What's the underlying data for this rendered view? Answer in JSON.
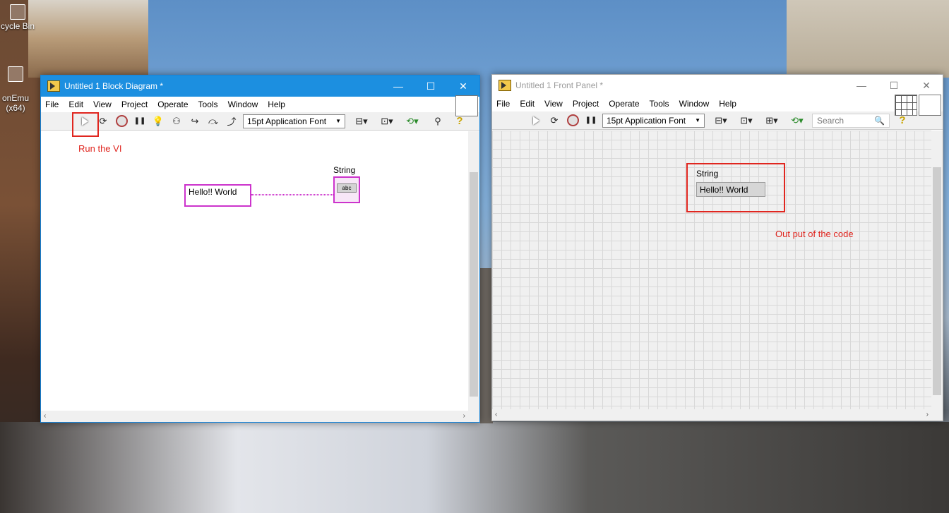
{
  "desktop": {
    "icons": [
      {
        "label": "cycle Bin"
      },
      {
        "label": "onEmu\n(x64)"
      }
    ]
  },
  "block_diagram": {
    "title": "Untitled 1 Block Diagram *",
    "menu": [
      "File",
      "Edit",
      "View",
      "Project",
      "Operate",
      "Tools",
      "Window",
      "Help"
    ],
    "font_select": "15pt Application Font",
    "annotation": "Run the VI",
    "constant_value": "Hello!! World",
    "indicator_label": "String",
    "indicator_type": "abc",
    "colors": {
      "wire": "#cc33cc",
      "annotation": "#e0261f"
    }
  },
  "front_panel": {
    "title": "Untitled 1 Front Panel *",
    "menu": [
      "File",
      "Edit",
      "View",
      "Project",
      "Operate",
      "Tools",
      "Window",
      "Help"
    ],
    "font_select": "15pt Application Font",
    "search_placeholder": "Search",
    "indicator_label": "String",
    "indicator_value": "Hello!! World",
    "annotation": "Out put of the code"
  }
}
